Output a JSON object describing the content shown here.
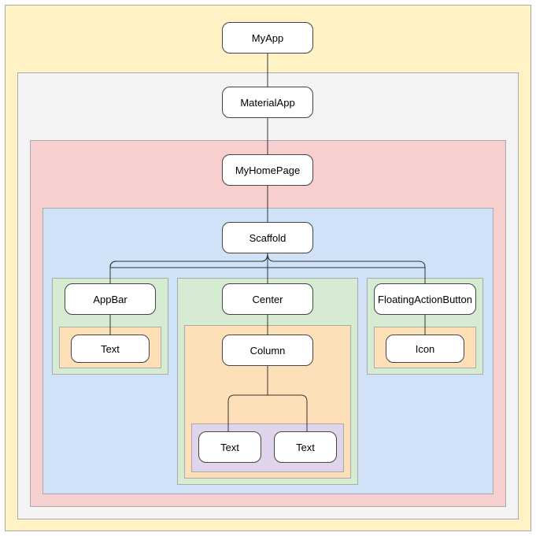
{
  "nodes": {
    "myapp": "MyApp",
    "materialapp": "MaterialApp",
    "myhomepage": "MyHomePage",
    "scaffold": "Scaffold",
    "appbar": "AppBar",
    "center": "Center",
    "fab": "FloatingActionButton",
    "text_appbar": "Text",
    "column": "Column",
    "icon": "Icon",
    "text_col1": "Text",
    "text_col2": "Text"
  },
  "colors": {
    "yellow": "#fff2c5",
    "grey": "#f4f4f4",
    "red": "#f7cfcf",
    "blue": "#cfe2f7",
    "green": "#d6ecd2",
    "orange": "#fde0b8",
    "purple": "#e0d4ec"
  }
}
